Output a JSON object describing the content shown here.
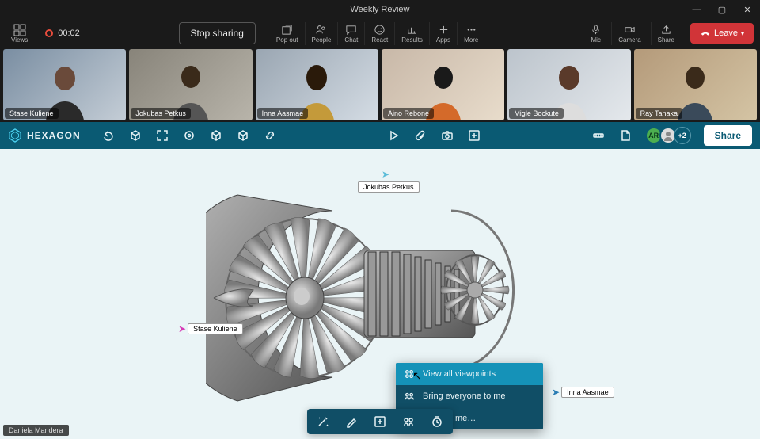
{
  "window": {
    "title": "Weekly Review",
    "controls": {
      "minimize": "—",
      "maximize": "▢",
      "close": "✕"
    }
  },
  "topbar": {
    "views_label": "Views",
    "rec_time": "00:02",
    "stop_sharing": "Stop sharing",
    "tools": [
      {
        "id": "popout",
        "label": "Pop out"
      },
      {
        "id": "people",
        "label": "People"
      },
      {
        "id": "chat",
        "label": "Chat"
      },
      {
        "id": "react",
        "label": "React"
      },
      {
        "id": "results",
        "label": "Results"
      },
      {
        "id": "apps",
        "label": "Apps"
      },
      {
        "id": "more",
        "label": "More"
      }
    ],
    "right_tools": [
      {
        "id": "mic",
        "label": "Mic"
      },
      {
        "id": "camera",
        "label": "Camera"
      },
      {
        "id": "share",
        "label": "Share"
      }
    ],
    "leave": "Leave"
  },
  "participants": [
    {
      "name": "Stase Kuliene"
    },
    {
      "name": "Jokubas Petkus"
    },
    {
      "name": "Inna Aasmae"
    },
    {
      "name": "Aino Rebone"
    },
    {
      "name": "Migle Bockute"
    },
    {
      "name": "Ray Tanaka"
    }
  ],
  "hexbar": {
    "brand": "HEXAGON",
    "avatar_initials": "AR",
    "more_count": "+2",
    "share": "Share"
  },
  "canvas": {
    "cursors": {
      "jp": "Jokubas Petkus",
      "sk": "Stase Kuliene",
      "ia": "Inna Aasmae"
    }
  },
  "context_menu": {
    "items": [
      {
        "label": "View all viewpoints",
        "selected": true
      },
      {
        "label": "Bring everyone to me",
        "selected": false
      },
      {
        "label": "Bring to me…",
        "selected": false
      }
    ]
  },
  "me_tag": "Daniela Mandera"
}
